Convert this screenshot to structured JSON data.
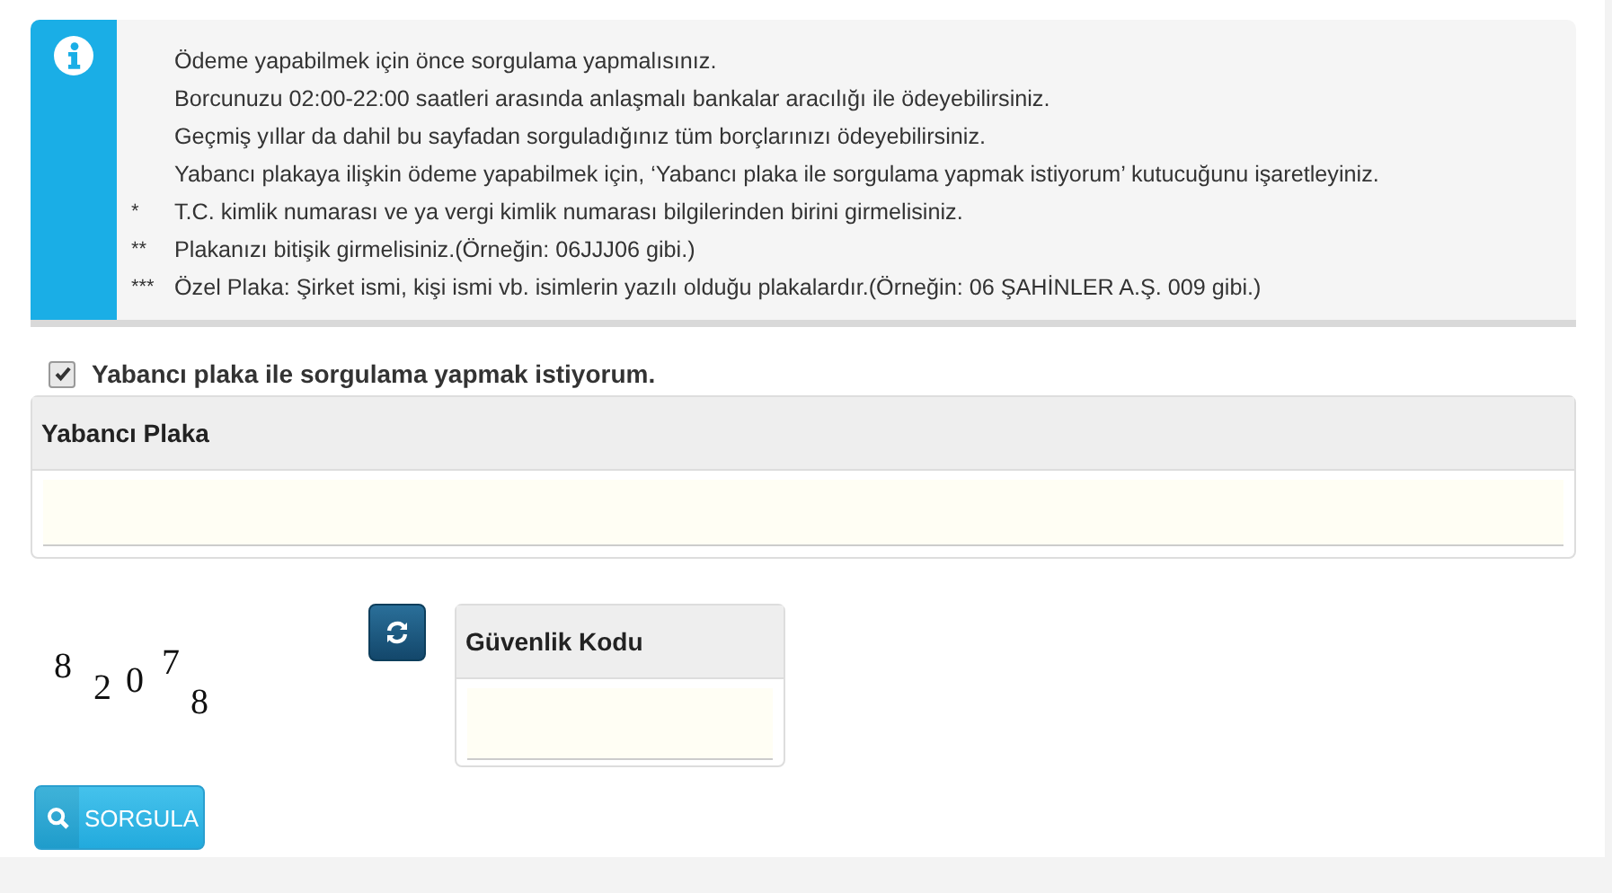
{
  "info_box": {
    "lines": [
      {
        "text": "Ödeme yapabilmek için önce sorgulama yapmalısınız."
      },
      {
        "text": "Borcunuzu 02:00-22:00 saatleri arasında anlaşmalı bankalar aracılığı ile ödeyebilirsiniz."
      },
      {
        "text": "Geçmiş yıllar da dahil bu sayfadan sorguladığınız tüm borçlarınızı ödeyebilirsiniz."
      },
      {
        "text": "Yabancı plakaya ilişkin ödeme yapabilmek için, ‘Yabancı plaka ile sorgulama yapmak istiyorum’ kutucuğunu işaretleyiniz."
      },
      {
        "marker": "*",
        "text": "T.C. kimlik numarası ve ya vergi kimlik numarası bilgilerinden birini girmelisiniz."
      },
      {
        "marker": "**",
        "text": "Plakanızı bitişik girmelisiniz.(Örneğin: 06JJJ06 gibi.)"
      },
      {
        "marker": "***",
        "text": "Özel Plaka: Şirket ismi, kişi ismi vb. isimlerin yazılı olduğu plakalardır.(Örneğin: 06 ŞAHİNLER A.Ş. 009 gibi.)"
      }
    ]
  },
  "foreign_plate_checkbox": {
    "label": "Yabancı plaka ile sorgulama yapmak istiyorum.",
    "checked": true
  },
  "foreign_plate_panel": {
    "title": "Yabancı Plaka"
  },
  "captcha": {
    "characters": [
      "8",
      "2",
      "0",
      "7",
      "8"
    ]
  },
  "security_code_panel": {
    "title": "Güvenlik Kodu"
  },
  "submit_button": {
    "label": "SORGULA"
  }
}
